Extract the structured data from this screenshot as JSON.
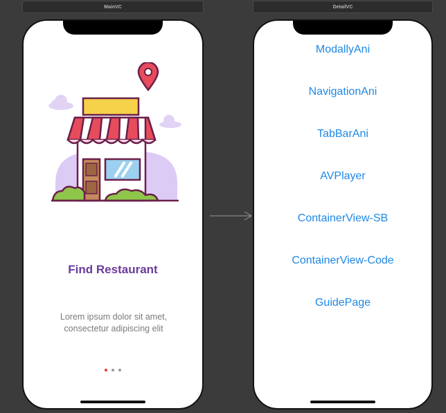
{
  "scenes": {
    "main": {
      "bar_label": "MainVC",
      "title": "Find Restaurant",
      "description": "Lorem ipsum dolor sit amet, consectetur adipiscing elit",
      "page_count": 3,
      "current_page": 1
    },
    "detail": {
      "bar_label": "DetailVC",
      "menu": [
        "ModallyAni",
        "NavigationAni",
        "TabBarAni",
        "AVPlayer",
        "ContainerView-SB",
        "ContainerView-Code",
        "GuidePage"
      ]
    }
  },
  "colors": {
    "title_purple": "#6b3b9c",
    "link_blue": "#1e88e5",
    "dot_active": "#e53935",
    "dot_inactive": "#9a9a9a"
  },
  "icons": {
    "illustration": "restaurant-storefront-illustration",
    "pin": "location-pin-icon",
    "segue": "segue-arrow-icon"
  }
}
